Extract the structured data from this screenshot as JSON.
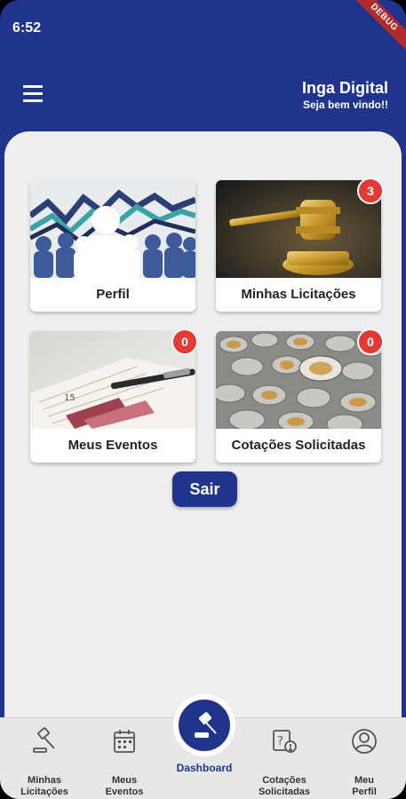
{
  "status": {
    "time": "6:52",
    "debug": "DEBUG"
  },
  "header": {
    "title": "Inga Digital",
    "subtitle": "Seja bem vindo!!"
  },
  "cards": [
    {
      "label": "Perfil",
      "badge": null
    },
    {
      "label": "Minhas Licitações",
      "badge": "3"
    },
    {
      "label": "Meus Eventos",
      "badge": "0"
    },
    {
      "label": "Cotações Solicitadas",
      "badge": "0"
    }
  ],
  "sair_label": "Sair",
  "nav": [
    {
      "line1": "Minhas",
      "line2": "Licitações",
      "icon": "gavel-icon"
    },
    {
      "line1": "Meus",
      "line2": "Eventos",
      "icon": "calendar-icon"
    },
    {
      "line1": "Dashboard",
      "icon": "gavel-icon"
    },
    {
      "line1": "Cotações",
      "line2": "Solicitadas",
      "icon": "quote-question-icon"
    },
    {
      "line1": "Meu",
      "line2": "Perfil",
      "icon": "user-icon"
    }
  ],
  "colors": {
    "primary": "#20348e",
    "badge": "#e53935",
    "background": "#efefef"
  }
}
